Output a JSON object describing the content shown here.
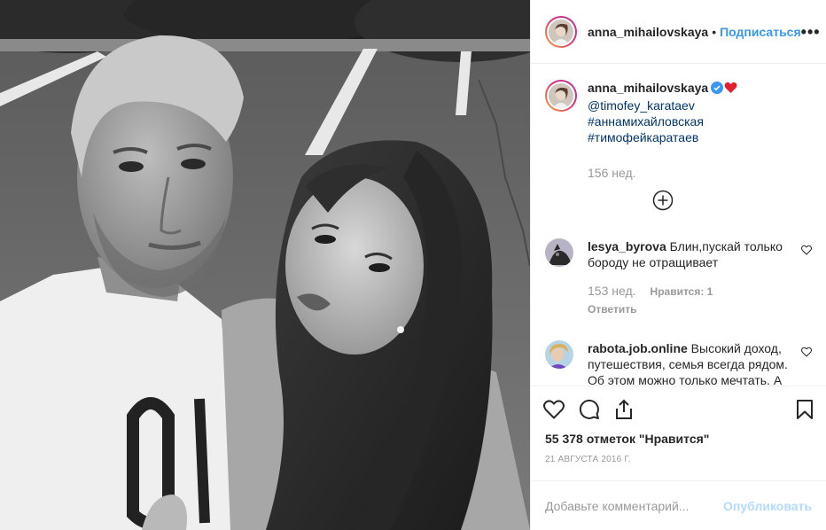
{
  "header": {
    "username": "anna_mihailovskaya",
    "separator": "•",
    "follow_label": "Подписаться",
    "more_label": "•••"
  },
  "caption": {
    "username": "anna_mihailovskaya",
    "mention": "@timofey_karataev",
    "hashtag1": "#аннамихайловская",
    "hashtag2": "#тимофейкаратаев",
    "age": "156 нед."
  },
  "comments": [
    {
      "username": "lesya_byrova",
      "text": "Блин,пускай только бороду не отращивает",
      "age": "153 нед.",
      "likes": "Нравится: 1",
      "reply": "Ответить"
    },
    {
      "username": "rabota.job.online",
      "text": "Высокий доход, путешествия, семья всегда рядом. Об этом можно только мечтать. А наша компания дает"
    }
  ],
  "likes_count": "55 378 отметок \"Нравится\"",
  "date": "21 АВГУСТА 2016 Г.",
  "add_comment": {
    "placeholder": "Добавьте комментарий...",
    "publish_label": "Опубликовать"
  },
  "icons": [
    "more-icon",
    "verified-icon",
    "red-heart-icon",
    "add-circle-icon",
    "heart-icon",
    "comment-icon",
    "share-icon",
    "bookmark-icon"
  ],
  "colors": {
    "link": "#003569",
    "follow": "#3897f0",
    "muted": "#999999",
    "publish_disabled": "#b3dbff",
    "heart_red": "#ed4956"
  }
}
